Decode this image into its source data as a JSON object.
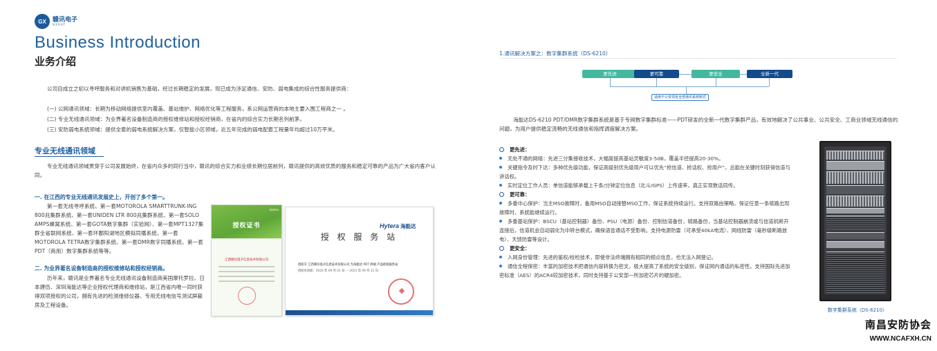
{
  "logo": {
    "mark": "GX",
    "name_cn": "赣讯电子",
    "name_en": "GXXUT"
  },
  "left": {
    "title_en": "Business Introduction",
    "title_cn": "业务介绍",
    "intro": "公司自成立之初以寻呼服务和对讲机销售为基础，经过长期稳定的发展，现已成为涉足通信、安防、弱电集成的综合性服务提供商：",
    "items": [
      "(一) 公网通讯领域：长期为移动网络提供室内覆盖、基站维护、网络优化等工程服务，系公网运营商的本地主要入围工程商之一 。",
      "(二) 专业无线通讯领域：为业界著名设备制造商的授权维修站和授权经销商，在省内的综合实力长期名列前茅。",
      "(三) 安防弱电系统领域：提供全套的弱电系统解决方案，仅智能小区领域，近五年完成的弱电配套工程量年均超过10万平米。"
    ],
    "wireless_heading": "专业无线通讯领域",
    "wireless_text": "专业无线通讯领域贯穿于公司发展始终，在省内众多的同行当中，赣讯的综合实力和业绩长期位居前列，赣讯提供的高效优质的服务和稳定可靠的产品为广大省内客户认同。",
    "sub1": "一. 在江西的专业无线通讯发展史上，开创了多个第一。",
    "body1": "第一套无线寻呼系统、第一套MOTOROLA SMARTTRUNK-ING 800兆集群系统、第一套UNIDEN LTR 800兆集群系统、第一套SOLO AMPS蜂窝系统、第一套GOTA数字集群（实验网）、第一套MPT1327集群全省联网系统、第一套环鄱阳湖地区模拟同播系统、第一套MOTOROLA TETRA数字集群系统、第一套DMR数字同播系统、第一套PDT（商用）数字集群系统等等。",
    "sub2": "二. 为业界著名设备制造商的授权维修站和授权经销商。",
    "body2": "历年来，赣讯是业界著名专业无线通讯设备制造商美国摩托罗拉、日本建伍、深圳海能达等企业授权代理商和维修站，是江西省内唯一同时获得双项授权的公司，拥有先进的检测维修仪器、专用无线电信号测试屏蔽房及工程设备。",
    "cert1": {
      "title": "授权证书",
      "brand": "Hytera",
      "company": "江西赣讯电子信息技术有限公司"
    },
    "cert2": {
      "brand": "Hytera",
      "brand_cn": "海能达",
      "title": "授 权 服 务 站",
      "line1": "授权于 江西赣讯电子信息技术有限公司 为海能达 PDT 终端 产品授权服务站",
      "line2": "授权有效期：2020 年 09 月 01 日 — 2021 年 09 月 21 日"
    }
  },
  "right": {
    "title": "1.通讯解决方案之：数字集群系统（DS-6210）",
    "diagram": {
      "boxes": [
        "更先进",
        "更可靠",
        "更安全",
        "全新一代"
      ],
      "note": "适用于公安现有全部通讯系统制式"
    },
    "intro": "海能达DS-6210 PDT/DMR数字集群系统是基于专网数字集群标准——PDT研发的全新一代数字集群产品，有效地解决了公共事业、公共安全、工商业领域无线通信的问题，为用户提供稳定流畅的无线通信和指挥调度解决方案。",
    "sections": [
      {
        "head": "更先进：",
        "bullets": [
          "无处不通的网络：先进三分集接收技术，大幅度提高基站灵敏度3-5dB，覆盖半径提高20-30%。",
          "关键指令及时下达：多种优先级功能，保证高级别优先级用户可以优先“抢信道、抢话权、抢用户”，总能在关键时刻获得信道与讲话权。",
          "实时定位工作人员：单信道能够承载上千条/分钟定位信息（北斗/GPS）上传速率，真正实现数话同传。"
        ]
      },
      {
        "head": "更可靠：",
        "bullets": [
          "多重中心保护：当主MSO故障时，备用MSO自动接替MSO工作，保证系统持续运行。支持双路由策略，保证任意一条链路出现故障时，系统能继续运行。",
          "多重基站保护：BSCU（基站控制器）备份、PSU（电源）备份、控制信道备份，链路备份，当基站控制器崩溃或与信道机断开连接后，信道机会自动弱化为中转台模式，确保语音通话不受影响。支持电源防雷（可承受40kA电流）、网线防雷（毫秒级断路放电）、天馈防雷等设计。"
        ]
      },
      {
        "head": "更安全：",
        "bullets": [
          "入网身份管理：先进的鉴权/校检技术，即使非法终端拥有相同的频点信息，也无法入网登记。",
          "通信全程保密：丰富的加密技术把通信内容转换为密文，极大提高了系统的安全级别，保证网内通话的私密性。支持国际先进加密标准（AES）的ACR4较加密技术，同时支持基于公安部一所加密芯片的硬加密。"
        ]
      }
    ],
    "cabinet_caption": "数字集群系统（DS-6210）",
    "association": "南昌安防协会",
    "association_url": "WWW.NCAFXH.CN"
  }
}
